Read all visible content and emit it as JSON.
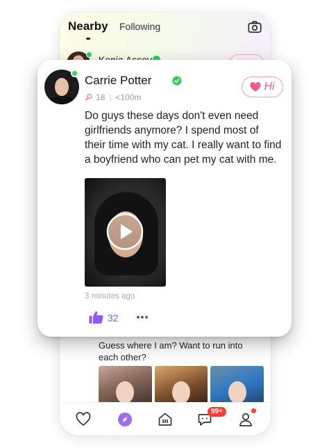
{
  "background": {
    "tabs": {
      "nearby": "Nearby",
      "following": "Following"
    },
    "peek_user": {
      "name": "Kenia Assey"
    },
    "post_text": "Guess where I am? Want to run into each other?",
    "tabbar": {
      "chat_badge": "99+"
    }
  },
  "card": {
    "user": {
      "name": "Carrie Potter",
      "age": "18",
      "distance": "<100m"
    },
    "hi_button": "Hi",
    "post_text": "Do guys these days don't even need girlfriends anymore? I spend most of their time with my cat. I really want to find a boyfriend who can pet my cat with me.",
    "timestamp": "3 minutes ago",
    "likes": "32"
  },
  "colors": {
    "accent_purple": "#8b5cf6",
    "online_green": "#2fcf5b",
    "hi_pink": "#ee5b93",
    "badge_red": "#ff3b30"
  },
  "icons": [
    "camera-icon",
    "verified-icon",
    "female-icon",
    "heart-icon",
    "play-icon",
    "thumbs-up-icon",
    "more-icon",
    "compass-icon",
    "home-icon",
    "chat-icon",
    "profile-icon"
  ]
}
